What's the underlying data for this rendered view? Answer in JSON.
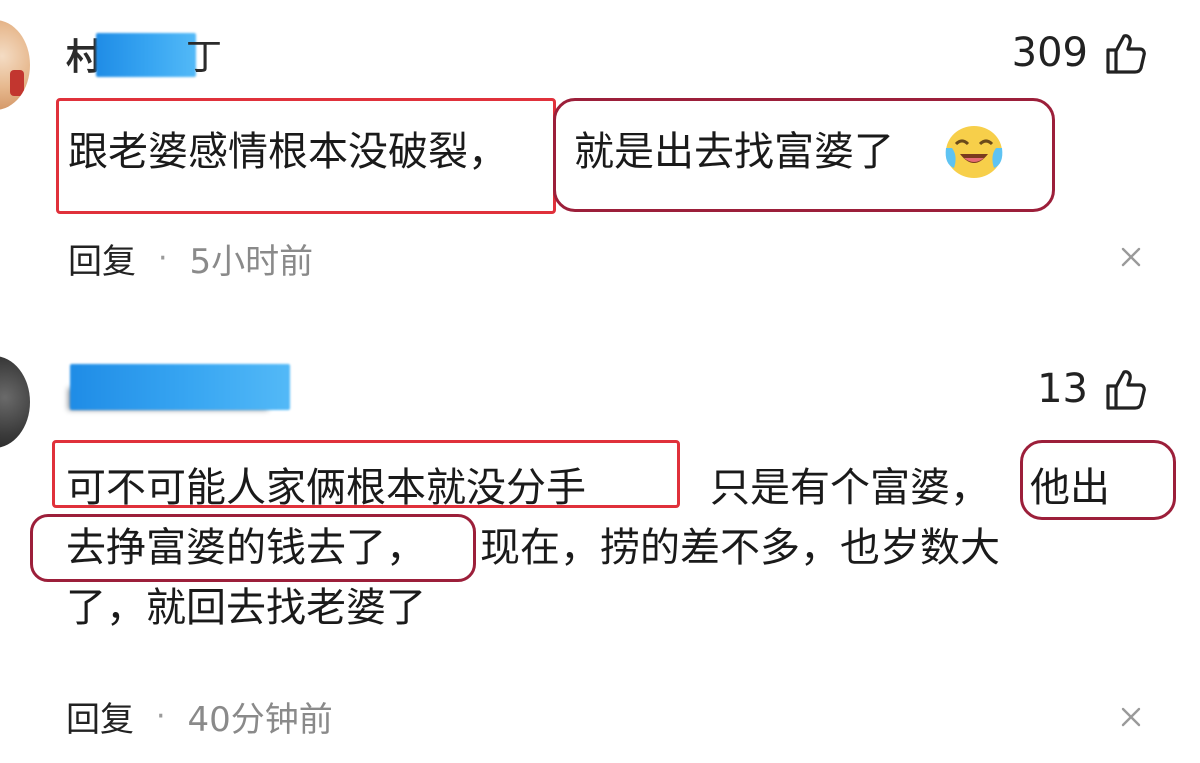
{
  "comments": [
    {
      "username_visible_first": "村",
      "username_visible_last": "丁",
      "likes": "309",
      "text": {
        "part1": "跟老婆感情根本没破裂，",
        "part2": "就是出去找富婆了"
      },
      "emoji": "crying-laughing-emoji",
      "reply_label": "回复",
      "separator": "·",
      "time": "5小时前"
    },
    {
      "likes": "13",
      "text": {
        "line1_a": "可不可能人家俩根本就没分手",
        "line1_b": "只是有个富婆，",
        "line1_c": "他出",
        "line2_a": "去挣富婆的钱去了，",
        "line2_b": "现在，捞的差不多，也岁数大",
        "line3": "了，就回去找老婆了"
      },
      "reply_label": "回复",
      "separator": "·",
      "time": "40分钟前"
    }
  ],
  "icons": {
    "like": "thumbs-up-icon",
    "dismiss": "close-icon"
  },
  "colors": {
    "highlight_box": "#e0313b",
    "highlight_oval": "#9c1f3a",
    "username_blur": "#2f9ff0",
    "meta_text": "#8a8a8a"
  }
}
